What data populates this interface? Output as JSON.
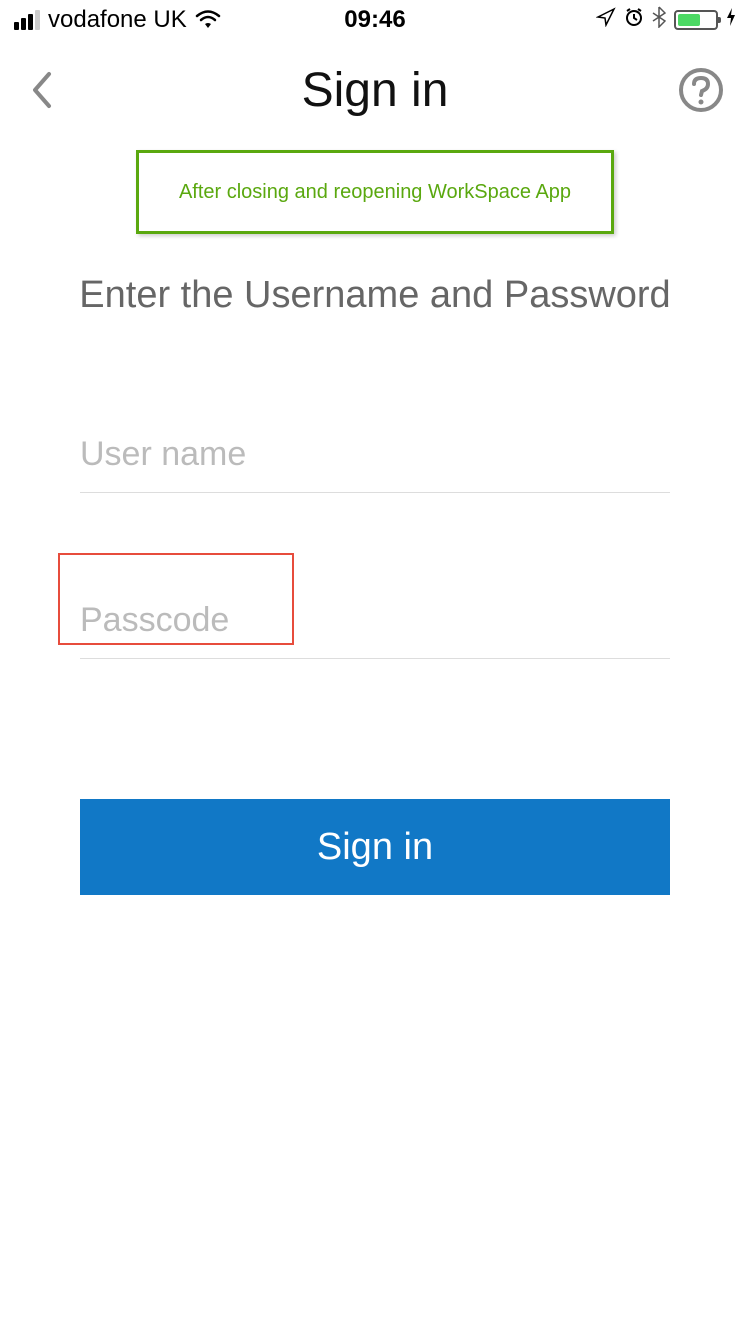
{
  "status_bar": {
    "carrier": "vodafone UK",
    "time": "09:46"
  },
  "header": {
    "title": "Sign in"
  },
  "banner": {
    "text": "After closing and reopening WorkSpace App"
  },
  "instruction": "Enter the Username and Password",
  "form": {
    "username_placeholder": "User name",
    "passcode_placeholder": "Passcode",
    "submit_label": "Sign in"
  }
}
